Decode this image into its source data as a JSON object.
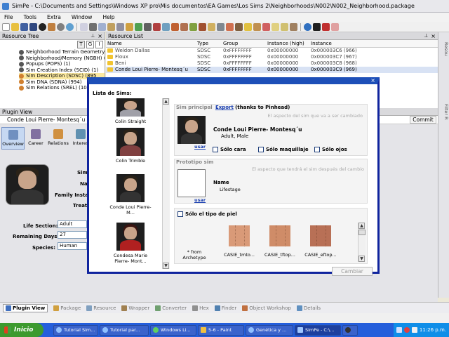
{
  "window": {
    "title": "SimPe - C:\\Documents and Settings\\Windows XP pro\\Mis documentos\\EA Games\\Los Sims 2\\Neighborhoods\\N002\\N002_Neighborhood.package"
  },
  "menu": [
    "File",
    "Tools",
    "Extra",
    "Window",
    "Help"
  ],
  "resource_tree": {
    "title": "Resource Tree",
    "items": [
      "Neighborhood Terrain Geometry",
      "Neighborhood/Memory (NGBH) (1",
      "Popups (POPS) (1)",
      "Sim Creation Index (SCID) (1)",
      "Sim Description (SDSC) (895",
      "Sim DNA (SDNA) (994)",
      "Sim Relations (SREL) (10643"
    ]
  },
  "resource_list": {
    "title": "Resource List",
    "columns": [
      "Name",
      "Type",
      "Group",
      "Instance (high)",
      "Instance"
    ],
    "rows": [
      [
        "Weldon Dallas",
        "SDSC",
        "0xFFFFFFFF",
        "0x00000000",
        "0x000003C6 (966)"
      ],
      [
        "Floux",
        "SDSC",
        "0xFFFFFFFF",
        "0x00000000",
        "0x000003C7 (967)"
      ],
      [
        "Beni",
        "SDSC",
        "0xFFFFFFFF",
        "0x00000000",
        "0x000003C8 (968)"
      ],
      [
        "Conde Loui Pierre- Montesq´u",
        "SDSC",
        "0xFFFFFFFF",
        "0x00000000",
        "0x000003C9 (969)"
      ]
    ]
  },
  "plugin_view": {
    "title": "Plugin View",
    "sim_title": "Conde Loui Pierre- Montesq´u",
    "commit_label": "Commit",
    "tabs": [
      "Overview",
      "Career",
      "Relations",
      "Interes"
    ],
    "fields": [
      {
        "label": "Sim",
        "value": ""
      },
      {
        "label": "Na",
        "value": ""
      },
      {
        "label": "Family Instan",
        "value": ""
      },
      {
        "label": "Treat",
        "value": ""
      }
    ],
    "life_section": {
      "label": "Life Section:",
      "value": "Adult"
    },
    "remaining_days": {
      "label": "Remaining Days:",
      "value": "27"
    },
    "species": {
      "label": "Species:",
      "value": "Human"
    }
  },
  "dialog": {
    "list_title": "Lista de Sims:",
    "sims": [
      "Colin Straight",
      "Colin Trimble",
      "Conde Loui Pierre- M...",
      "Condesa Marie Pierre- Mont..."
    ],
    "principal": {
      "title": "Sim principal",
      "export_link": "Export",
      "thanks": "(thanks to Pinhead)",
      "note": "El aspecto del sim que va a ser cambiado",
      "name": "Conde Loui Pierre- Montesq´u",
      "desc": "Adult, Male",
      "usar": "usar"
    },
    "options": [
      "Sólo cara",
      "Sólo maquillaje",
      "Sólo ojos"
    ],
    "prototipo": {
      "title": "Prototipo sim",
      "note": "El aspecto que tendrá el sim después del cambio",
      "name_label": "Name",
      "life_label": "Lifestage",
      "usar": "usar"
    },
    "skin": {
      "label": "Sólo el tipo de piel",
      "from": "* from Archetype",
      "items": [
        "CASIE_tmto...",
        "CASIE_tftop...",
        "CASIE_eftop..."
      ]
    },
    "change_button": "Cambiar"
  },
  "side_labels": [
    "Resou",
    "Filter R"
  ],
  "bottom_tabs": [
    "Plugin View",
    "Package",
    "Resource",
    "Wrapper",
    "Converter",
    "Hex",
    "Finder",
    "Object Workshop",
    "Details"
  ],
  "taskbar": {
    "start": "Inicio",
    "tasks": [
      "Tutorial Sim...",
      "Tutorial par...",
      "Windows Li...",
      "5-6 - Paint",
      "Genética y ...",
      "SimPe - C:\\..."
    ],
    "clock": "11:26 p.m."
  },
  "colors": {
    "dialog_border": "#10249e",
    "taskbar": "#245edb",
    "start": "#3c9a2e",
    "link": "#1a3fb0"
  }
}
